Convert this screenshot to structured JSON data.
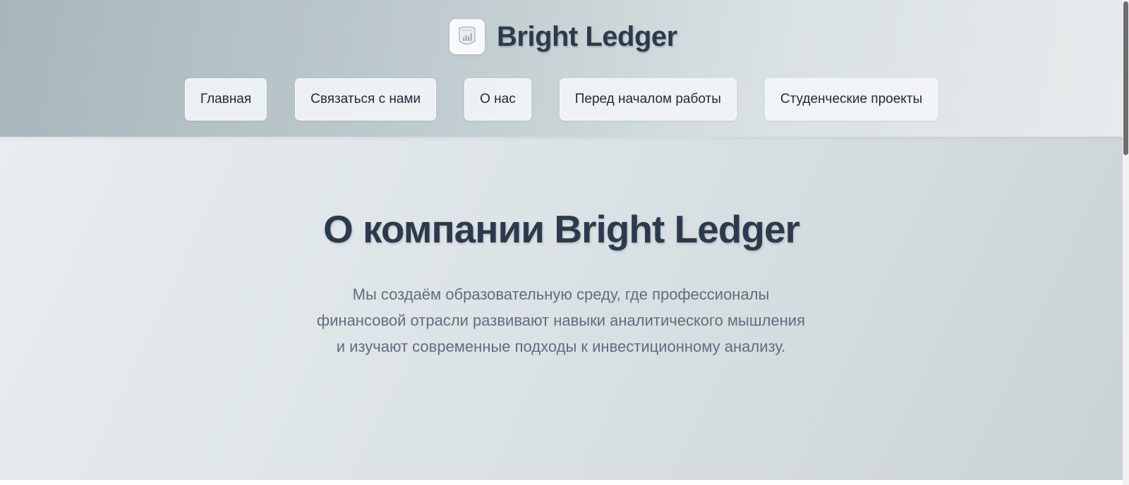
{
  "brand": {
    "name": "Bright Ledger",
    "logo_icon": "ledger-chart-icon"
  },
  "nav": {
    "items": [
      {
        "label": "Главная"
      },
      {
        "label": "Связаться с нами"
      },
      {
        "label": "О нас"
      },
      {
        "label": "Перед началом работы"
      },
      {
        "label": "Студенческие проекты"
      }
    ]
  },
  "hero": {
    "title": "О компании Bright Ledger",
    "description": "Мы создаём образовательную среду, где профессионалы финансовой отрасли развивают навыки аналитического мышления и изучают современные подходы к инвестиционному анализу."
  },
  "colors": {
    "title_text": "#2b3a4d",
    "body_text": "#5e6e7c",
    "nav_text": "#1e2a38",
    "header_bg_start": "#a8b6bb",
    "header_bg_end": "#e6ebec",
    "hero_bg_start": "#e8edef",
    "hero_bg_end": "#c9d3d5"
  }
}
